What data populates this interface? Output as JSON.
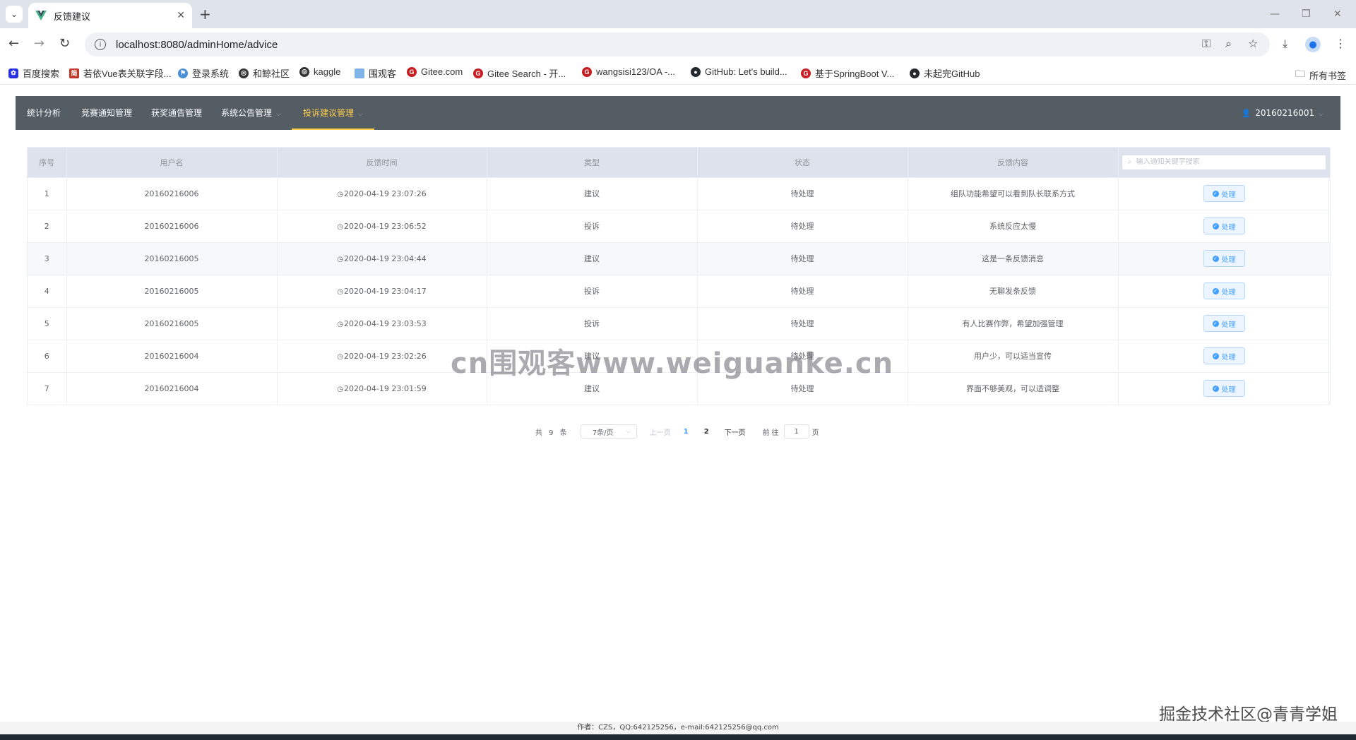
{
  "browser": {
    "tab_title": "反馈建议",
    "url": "localhost:8080/adminHome/advice",
    "bookmarks": [
      {
        "label": "百度搜索",
        "color": "#2932e1"
      },
      {
        "label": "若依Vue表关联字段...",
        "color": "#c0392b"
      },
      {
        "label": "登录系统",
        "color": "#4a90d9"
      },
      {
        "label": "和鲸社区",
        "color": "#333333"
      },
      {
        "label": "kaggle",
        "color": "#333333"
      },
      {
        "label": "围观客",
        "color": "#7fb5e6"
      },
      {
        "label": "Gitee.com",
        "color": "#c71d23"
      },
      {
        "label": "Gitee Search - 开...",
        "color": "#c71d23"
      },
      {
        "label": "wangsisi123/OA -...",
        "color": "#c71d23"
      },
      {
        "label": "GitHub: Let's build...",
        "color": "#24292e"
      },
      {
        "label": "基于SpringBoot V...",
        "color": "#c71d23"
      },
      {
        "label": "未起完GitHub",
        "color": "#24292e"
      }
    ],
    "all_bookmarks": "所有书签"
  },
  "nav": {
    "items": [
      {
        "label": "统计分析",
        "dropdown": false,
        "active": false
      },
      {
        "label": "竞赛通知管理",
        "dropdown": false,
        "active": false
      },
      {
        "label": "获奖通告管理",
        "dropdown": false,
        "active": false
      },
      {
        "label": "系统公告管理",
        "dropdown": true,
        "active": false
      },
      {
        "label": "投诉建议管理",
        "dropdown": true,
        "active": true
      }
    ],
    "user": "20160216001",
    "active_color": "#ffd04b"
  },
  "table": {
    "headers": [
      "序号",
      "用户名",
      "反馈时间",
      "类型",
      "状态",
      "反馈内容"
    ],
    "search_placeholder": "输入通知关键字搜索",
    "action_label": "处理",
    "rows": [
      {
        "index": "1",
        "username": "20160216006",
        "time": "2020-04-19 23:07:26",
        "type": "建议",
        "status": "待处理",
        "content": "组队功能希望可以看到队长联系方式"
      },
      {
        "index": "2",
        "username": "20160216006",
        "time": "2020-04-19 23:06:52",
        "type": "投诉",
        "status": "待处理",
        "content": "系统反应太慢"
      },
      {
        "index": "3",
        "username": "20160216005",
        "time": "2020-04-19 23:04:44",
        "type": "建议",
        "status": "待处理",
        "content": "这是一条反馈消息"
      },
      {
        "index": "4",
        "username": "20160216005",
        "time": "2020-04-19 23:04:17",
        "type": "投诉",
        "status": "待处理",
        "content": "无聊发条反馈"
      },
      {
        "index": "5",
        "username": "20160216005",
        "time": "2020-04-19 23:03:53",
        "type": "投诉",
        "status": "待处理",
        "content": "有人比赛作弊，希望加强管理"
      },
      {
        "index": "6",
        "username": "20160216004",
        "time": "2020-04-19 23:02:26",
        "type": "建议",
        "status": "待处理",
        "content": "用户少，可以适当宣传"
      },
      {
        "index": "7",
        "username": "20160216004",
        "time": "2020-04-19 23:01:59",
        "type": "建议",
        "status": "待处理",
        "content": "界面不够美观，可以适调整"
      }
    ]
  },
  "pagination": {
    "total": "共 9 条",
    "page_size": "7条/页",
    "prev": "上一页",
    "pages": [
      "1",
      "2"
    ],
    "current": "1",
    "next": "下一页",
    "goto_label": "前往",
    "goto_value": "1",
    "page_unit": "页"
  },
  "watermark": "cn围观客www.weiguanke.cn",
  "corner_watermark": "掘金技术社区@青青学姐",
  "footer": "作者：CZS，QQ:642125256，e-mail:642125256@qq.com"
}
